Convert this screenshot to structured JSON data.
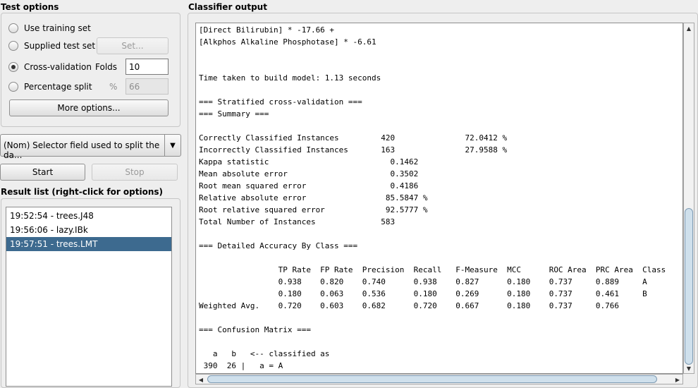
{
  "test_options": {
    "title": "Test options",
    "use_training_set": "Use training set",
    "supplied_test_set": "Supplied test set",
    "set_button": "Set...",
    "cross_validation": "Cross-validation",
    "folds_label": "Folds",
    "folds_value": "10",
    "percentage_split": "Percentage split",
    "percent_symbol": "%",
    "percentage_value": "66",
    "more_options": "More options...",
    "selected": "cross-validation"
  },
  "class_selector": {
    "value": "(Nom) Selector field used to split the da..."
  },
  "actions": {
    "start": "Start",
    "stop": "Stop"
  },
  "result_list": {
    "title": "Result list (right-click for options)",
    "items": [
      "19:52:54 - trees.J48",
      "19:56:06 - lazy.IBk",
      "19:57:51 - trees.LMT"
    ],
    "selected_index": 2
  },
  "classifier_output": {
    "title": "Classifier output",
    "lines": [
      "[Direct Bilirubin] * -17.66 +",
      "[Alkphos Alkaline Phosphotase] * -6.61",
      "",
      "",
      "Time taken to build model: 1.13 seconds",
      "",
      "=== Stratified cross-validation ===",
      "=== Summary ===",
      "",
      "Correctly Classified Instances         420               72.0412 %",
      "Incorrectly Classified Instances       163               27.9588 %",
      "Kappa statistic                          0.1462",
      "Mean absolute error                      0.3502",
      "Root mean squared error                  0.4186",
      "Relative absolute error                 85.5847 %",
      "Root relative squared error             92.5777 %",
      "Total Number of Instances              583",
      "",
      "=== Detailed Accuracy By Class ===",
      "",
      "                 TP Rate  FP Rate  Precision  Recall   F-Measure  MCC      ROC Area  PRC Area  Class",
      "                 0.938    0.820    0.740      0.938    0.827      0.180    0.737     0.889     A",
      "                 0.180    0.063    0.536      0.180    0.269      0.180    0.737     0.461     B",
      "Weighted Avg.    0.720    0.603    0.682      0.720    0.667      0.180    0.737     0.766",
      "",
      "=== Confusion Matrix ===",
      "",
      "   a   b   <-- classified as",
      " 390  26 |   a = A"
    ]
  },
  "colors": {
    "selection": "#3d6a8f",
    "scrollbar_thumb": "#cfe0ec"
  }
}
